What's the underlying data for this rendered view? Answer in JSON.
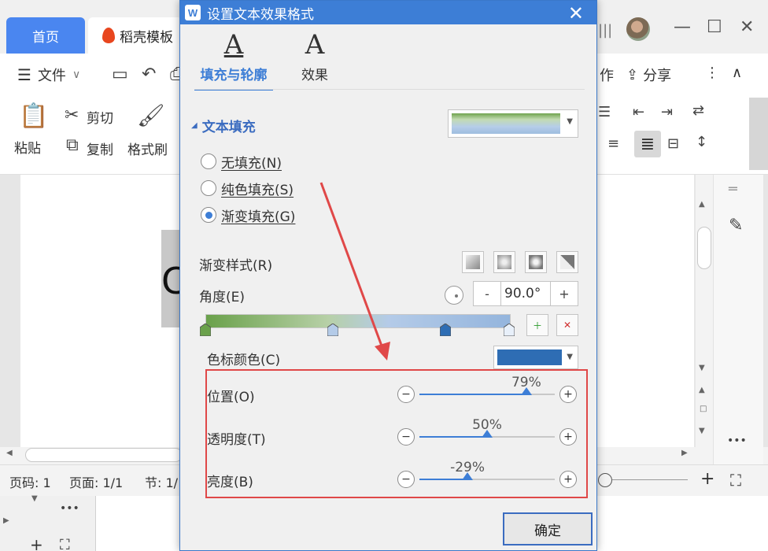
{
  "app": {
    "tabs": {
      "home": "首页",
      "daoke": "稻壳模板"
    },
    "window_controls": {
      "minimize": "—",
      "maximize": "☐",
      "close": "✕"
    }
  },
  "menubar": {
    "file": "文件",
    "file_arrow": "∨",
    "collab": "作",
    "share": "分享",
    "more": "⋮",
    "collapse": "∧"
  },
  "ribbon": {
    "paste": "粘贴",
    "cut": "剪切",
    "copy": "复制",
    "format_painter": "格式刷"
  },
  "status": {
    "page_num": "页码: 1",
    "pages": "页面: 1/1",
    "section": "节: 1/"
  },
  "sidepanel": {
    "more": "•••"
  },
  "below": {
    "more": "•••"
  },
  "doc": {
    "glyph": "C"
  },
  "dialog": {
    "title": "设置文本效果格式",
    "close": "✕",
    "tabs": [
      {
        "label": "填充与轮廓",
        "glyph": "A",
        "active": true
      },
      {
        "label": "效果",
        "glyph": "A",
        "active": false
      }
    ],
    "section_title": "文本填充",
    "fill_options": [
      {
        "label": "无填充(N)",
        "selected": false
      },
      {
        "label": "纯色填充(S)",
        "selected": false
      },
      {
        "label": "渐变填充(G)",
        "selected": true
      }
    ],
    "gradient_style_label": "渐变样式(R)",
    "angle_label": "角度(E)",
    "angle_value": "90.0°",
    "stepper_minus": "-",
    "stepper_plus": "+",
    "stop_color_label": "色标颜色(C)",
    "stop_color": "#2e6db4",
    "gradient_stops": [
      0,
      0.42,
      0.79,
      1.0
    ],
    "sliders": [
      {
        "label": "位置(O)",
        "value_text": "79%",
        "fraction": 0.79
      },
      {
        "label": "透明度(T)",
        "value_text": "50%",
        "fraction": 0.5
      },
      {
        "label": "亮度(B)",
        "value_text": "-29%",
        "fraction": 0.355
      }
    ],
    "minus": "−",
    "plus": "+",
    "ok": "确定"
  },
  "colors": {
    "accent": "#3d7ed6",
    "highlight": "#e04848"
  }
}
